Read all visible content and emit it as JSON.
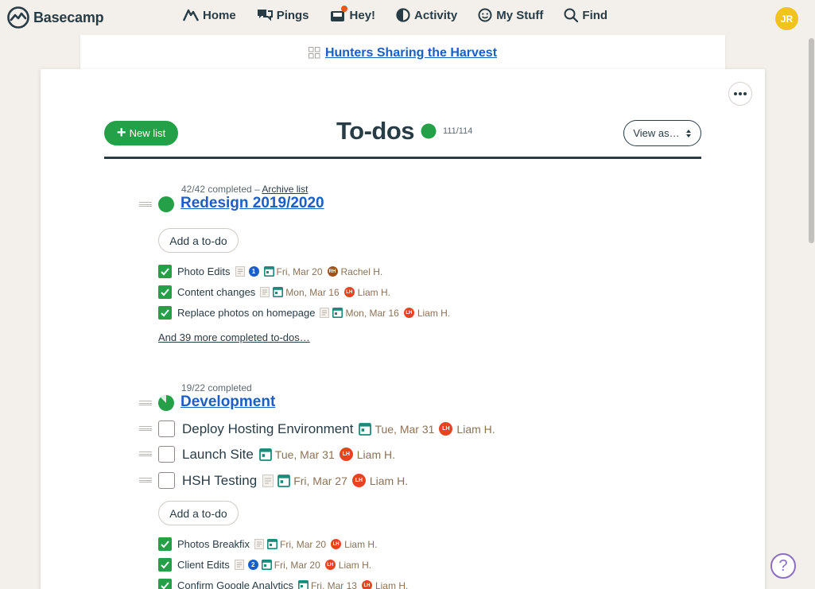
{
  "app": {
    "name": "Basecamp"
  },
  "nav": {
    "items": [
      {
        "label": "Home",
        "icon": "home-icon"
      },
      {
        "label": "Pings",
        "icon": "pings-icon"
      },
      {
        "label": "Hey!",
        "icon": "hey-icon"
      },
      {
        "label": "Activity",
        "icon": "activity-icon"
      },
      {
        "label": "My Stuff",
        "icon": "my-stuff-icon"
      },
      {
        "label": "Find",
        "icon": "search-icon"
      }
    ],
    "user_initials": "JR"
  },
  "project": {
    "name": "Hunters Sharing the Harvest"
  },
  "toolbar": {
    "new_list_label": "New list",
    "view_as_label": "View as…"
  },
  "page": {
    "title": "To-dos",
    "progress": "111/114"
  },
  "lists": [
    {
      "meta": "42/42 completed –",
      "archive_label": "Archive list",
      "title": "Redesign 2019/2020",
      "add_todo_label": "Add a to-do",
      "completed": [
        {
          "text": "Photo Edits",
          "comments": "1",
          "date": "Fri, Mar 20",
          "assignee_initials": "RH",
          "assignee": "Rachel H.",
          "avatar_color": "#a0521b"
        },
        {
          "text": "Content changes",
          "date": "Mon, Mar 16",
          "assignee_initials": "LH",
          "assignee": "Liam H.",
          "avatar_color": "#e8431f"
        },
        {
          "text": "Replace photos on homepage",
          "date": "Mon, Mar 16",
          "assignee_initials": "LH",
          "assignee": "Liam H.",
          "avatar_color": "#e8431f"
        }
      ],
      "more_completed": "And 39 more completed to-dos…"
    },
    {
      "meta": "19/22 completed",
      "title": "Development",
      "open": [
        {
          "text": "Deploy Hosting Environment",
          "date": "Tue, Mar 31",
          "assignee_initials": "LH",
          "assignee": "Liam H."
        },
        {
          "text": "Launch Site",
          "date": "Tue, Mar 31",
          "assignee_initials": "LH",
          "assignee": "Liam H."
        },
        {
          "text": "HSH Testing",
          "date": "Fri, Mar 27",
          "assignee_initials": "LH",
          "assignee": "Liam H."
        }
      ],
      "add_todo_label": "Add a to-do",
      "completed": [
        {
          "text": "Photos Breakfix",
          "date": "Fri, Mar 20",
          "assignee_initials": "LH",
          "assignee": "Liam H."
        },
        {
          "text": "Client Edits",
          "comments": "2",
          "date": "Fri, Mar 20",
          "assignee_initials": "LH",
          "assignee": "Liam H."
        },
        {
          "text": "Confirm Google Analytics",
          "date": "Fri, Mar 13",
          "assignee_initials": "LH",
          "assignee": "Liam H."
        }
      ]
    }
  ],
  "help": {
    "label": "?"
  },
  "colors": {
    "brand_green": "#24a148",
    "link_blue": "#1a5ec7",
    "assignee_orange": "#e8431f",
    "avatar_yellow": "#f2c31d"
  }
}
